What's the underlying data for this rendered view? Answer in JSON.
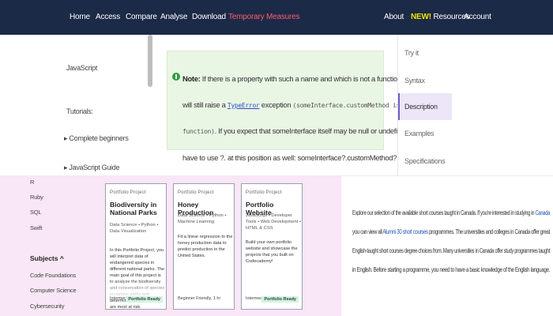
{
  "nav": {
    "left": [
      "Home",
      "Access",
      "Compare",
      "Analyse",
      "Download",
      "Temporary Measures"
    ],
    "right_about": "About",
    "new_badge": "NEW!",
    "resources": "Resources",
    "account": "Account"
  },
  "left_menu": {
    "javascript": "JavaScript",
    "tutorials": "Tutorials:",
    "complete_beginners": "Complete beginners",
    "js_guide": "JavaScript Guide"
  },
  "note": {
    "label": "Note:",
    "line1a": "If there is a property with such a name and which is not a function, using",
    "line1b": "?.",
    "line2a": "will still raise a",
    "line2_link": "TypeError",
    "line2b": "exception",
    "line2_code": "(someInterface.customMethod is not a",
    "line3_code": "function)",
    "line3b": ". If you expect that someInterface itself may be null or undefined, you",
    "line4": "have to use ?. at this position as well: someInterface?.customMethod?.()"
  },
  "right_nav": [
    "Try it",
    "Syntax",
    "Description",
    "Examples",
    "Specifications"
  ],
  "pink_side": {
    "items": [
      "R",
      "Ruby",
      "SQL",
      "Swift"
    ],
    "subjects": "Subjects",
    "subject_items": [
      "Code Foundations",
      "Computer Science",
      "Cybersecurity"
    ]
  },
  "cards": [
    {
      "tag": "Portfolio Project",
      "title": "Biodiversity in National Parks",
      "subtitle": "Data Science • Python • Data Visualization",
      "desc": "In this Portfolio Project, you will interpret data of endangered species in different national parks. The main goal of this project is to analyze the biodiversity and conservation of species in various parks and determine which species are most at risk.",
      "meta": "Intermediate, 5 hrs",
      "pill": "Portfolio Ready"
    },
    {
      "tag": "Portfolio Project",
      "title": "Honey Production",
      "subtitle": "Data Science • Python • Machine Learning",
      "desc": "Fit a linear regression to the honey production data to predict production in the United States.",
      "meta": "Beginner Friendly, 1 hr",
      "pill": ""
    },
    {
      "tag": "Portfolio Project",
      "title": "Portfolio Website",
      "subtitle": "JavaScript • Developer Tools • Web Development • HTML & CSS",
      "desc": "Build your own portfolio website and showcase the projects that you built on Codecademy!",
      "meta": "Intermediate, 2 hrs",
      "pill": "Portfolio Ready"
    }
  ],
  "paragraph": {
    "l1a": "Explore our selection of the available short courses taught in Canada. If you're interested in studying in",
    "l1_link": "Canada",
    "l2a": "you can view all",
    "l2_link": "Alumni 30 short courses",
    "l2b": "programmes. The universities and colleges in Canada offer great",
    "l3": "English-taught short courses degree choices from. Many universities in Canada offer study programmes taught",
    "l4": "in English. Before starting a programme, you need to have a basic knowledge of the English language."
  }
}
